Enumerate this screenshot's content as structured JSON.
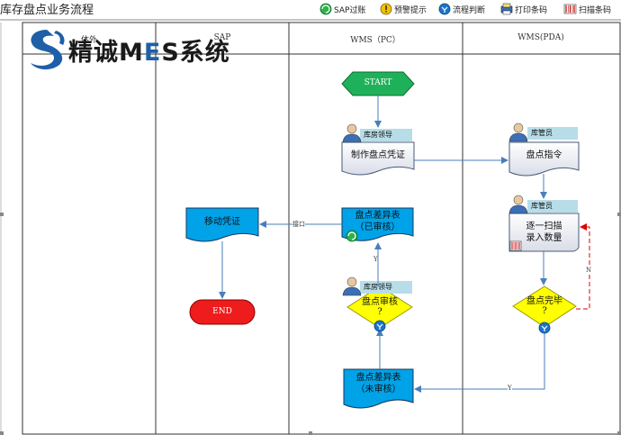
{
  "title": "库存盘点业务流程",
  "logo": {
    "text_parts": [
      "精诚M",
      "E",
      "S系统"
    ]
  },
  "legend": [
    {
      "icon": "sap-sync-icon",
      "label": "SAP过账"
    },
    {
      "icon": "warning-icon",
      "label": "预警提示"
    },
    {
      "icon": "decision-icon",
      "label": "流程判断"
    },
    {
      "icon": "printer-icon",
      "label": "打印条码"
    },
    {
      "icon": "barcode-scan-icon",
      "label": "扫描条码"
    }
  ],
  "lanes": [
    "体外",
    "SAP",
    "WMS（PC）",
    "WMS(PDA)"
  ],
  "nodes": {
    "start": "START",
    "end": "END",
    "make_voucher": "制作盘点凭证",
    "count_order": "盘点指令",
    "scan_line1": "逐一扫描",
    "scan_line2": "录入数量",
    "count_done_line1": "盘点完毕",
    "count_done_line2": "?",
    "diff_unreviewed_line1": "盘点差异表",
    "diff_unreviewed_line2": "（未审核）",
    "review_line1": "盘点审核",
    "review_line2": "?",
    "diff_reviewed_line1": "盘点差异表",
    "diff_reviewed_line2": "（已审核）",
    "move_voucher": "移动凭证"
  },
  "roles": {
    "warehouse_lead_1": "库房领导",
    "warehouse_keeper_1": "库管员",
    "warehouse_keeper_2": "库管员",
    "warehouse_lead_2": "库房领导"
  },
  "edge_labels": {
    "interface": "接口",
    "yes_review": "Y",
    "no_count": "N",
    "yes_count": "Y"
  },
  "colors": {
    "start": "#1fb15a",
    "end": "#ee1c1c",
    "document": "#00a2e8",
    "decision": "#ffff00",
    "role_tab": "#b7dde8",
    "connector": "#4a7ebb",
    "no_line": "#e00000"
  }
}
